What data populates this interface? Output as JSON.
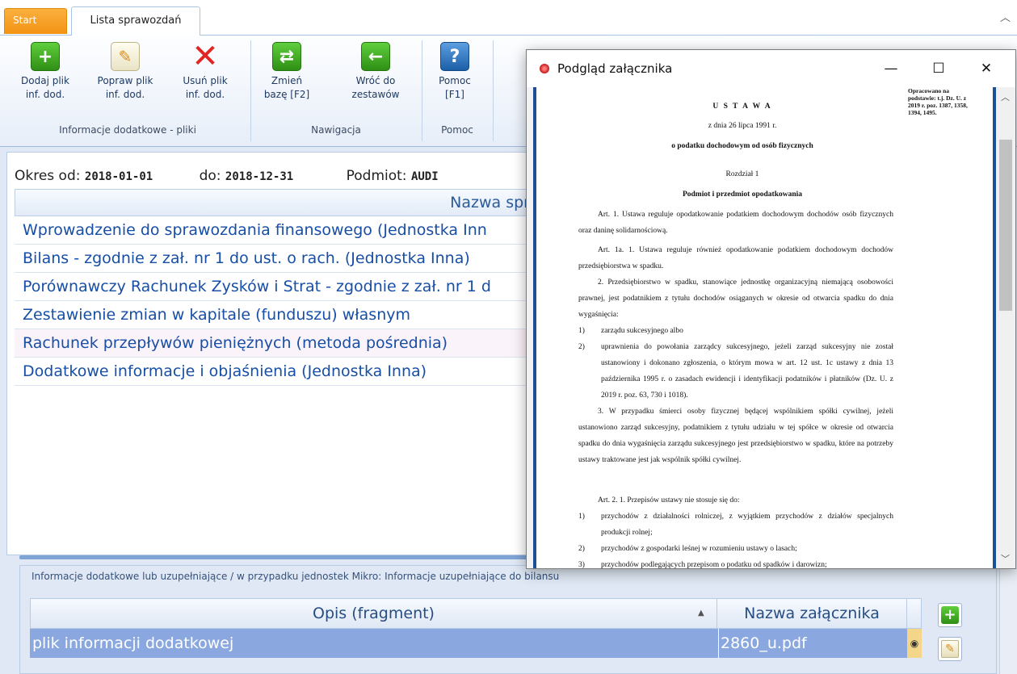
{
  "tabs": {
    "start": "Start",
    "list": "Lista sprawozdań",
    "collapse_icon": "chevron-up-icon"
  },
  "ribbon": {
    "buttons": [
      {
        "line1": "Dodaj plik",
        "line2": "inf. dod.",
        "icon": "add-icon"
      },
      {
        "line1": "Popraw plik",
        "line2": "inf. dod.",
        "icon": "edit-note-icon"
      },
      {
        "line1": "Usuń plik",
        "line2": "inf. dod.",
        "icon": "delete-icon"
      },
      {
        "line1": "Zmień",
        "line2": "bazę [F2]",
        "icon": "swap-icon"
      },
      {
        "line1": "Wróć do",
        "line2": "zestawów",
        "icon": "arrow-left-icon"
      },
      {
        "line1": "Pomoc",
        "line2": "[F1]",
        "icon": "help-icon"
      }
    ],
    "groups": [
      "Informacje dodatkowe - pliki",
      "Nawigacja",
      "Pomoc"
    ]
  },
  "filters": {
    "from_label": "Okres od:",
    "from_value": "2018-01-01",
    "to_label": "do:",
    "to_value": "2018-12-31",
    "entity_label": "Podmiot:",
    "entity_value": "AUDI"
  },
  "grid": {
    "header": "Nazwa sprawo",
    "rows": [
      "Wprowadzenie do sprawozdania finansowego (Jednostka Inn",
      "Bilans - zgodnie z zał. nr 1 do ust. o rach. (Jednostka Inna)",
      "Porównawczy Rachunek Zysków i Strat - zgodnie z zał. nr 1 d",
      "Zestawienie zmian w kapitale (funduszu) własnym",
      "Rachunek przepływów pieniężnych (metoda pośrednia)",
      "Dodatkowe informacje i objaśnienia (Jednostka Inna)"
    ]
  },
  "attachments": {
    "caption": "Informacje dodatkowe lub uzupełniające / w przypadku jednostek Mikro: Informacje uzupełniające do bilansu",
    "columns": [
      "Opis (fragment)",
      "Nazwa załącznika"
    ],
    "rows": [
      {
        "desc": "plik informacji dodatkowej",
        "file": "2860_u.pdf"
      }
    ]
  },
  "preview": {
    "title": "Podgląd załącznika",
    "controls": {
      "minimize": "—",
      "maximize": "☐",
      "close": "✕"
    },
    "doc": {
      "note": "Opracowano na podstawie: t.j. Dz. U. z 2019 r. poz. 1387, 1358, 1394, 1495.",
      "heading": "U S T A W A",
      "date": "z dnia 26 lipca 1991 r.",
      "subject": "o podatku dochodowym od osób fizycznych",
      "chapter": "Rozdział 1",
      "chapter_title": "Podmiot i przedmiot opodatkowania",
      "art1": "Art. 1. Ustawa reguluje opodatkowanie podatkiem dochodowym dochodów osób fizycznych oraz daninę solidarnościową.",
      "art1a": "Art. 1a. 1. Ustawa reguluje również opodatkowanie podatkiem dochodowym dochodów przedsiębiorstwa w spadku.",
      "art1a_2": "2. Przedsiębiorstwo w spadku, stanowiące jednostkę organizacyjną niemającą osobowości prawnej, jest podatnikiem z tytułu dochodów osiąganych w okresie od otwarcia spadku do dnia wygaśnięcia:",
      "art1a_2_items": [
        "zarządu sukcesyjnego albo",
        "uprawnienia do powołania zarządcy sukcesyjnego, jeżeli zarząd sukcesyjny nie został ustanowiony i dokonano zgłoszenia, o którym mowa w art. 12 ust. 1c ustawy z dnia 13 października 1995 r. o zasadach ewidencji i identyfikacji podatników i płatników (Dz. U. z 2019 r. poz. 63, 730 i 1018)."
      ],
      "art1a_3": "3. W przypadku śmierci osoby fizycznej będącej wspólnikiem spółki cywilnej, jeżeli ustanowiono zarząd sukcesyjny, podatnikiem z tytułu udziału w tej spółce w okresie od otwarcia spadku do dnia wygaśnięcia zarządu sukcesyjnego jest przedsiębiorstwo w spadku, które na potrzeby ustawy traktowane jest jak wspólnik spółki cywilnej.",
      "art2": "Art. 2. 1. Przepisów ustawy nie stosuje się do:",
      "art2_items": [
        "przychodów z działalności rolniczej, z wyjątkiem przychodów z działów specjalnych produkcji rolnej;",
        "przychodów z gospodarki leśnej w rozumieniu ustawy o lasach;",
        "przychodów podlegających przepisom o podatku od spadków i darowizn;"
      ]
    }
  }
}
